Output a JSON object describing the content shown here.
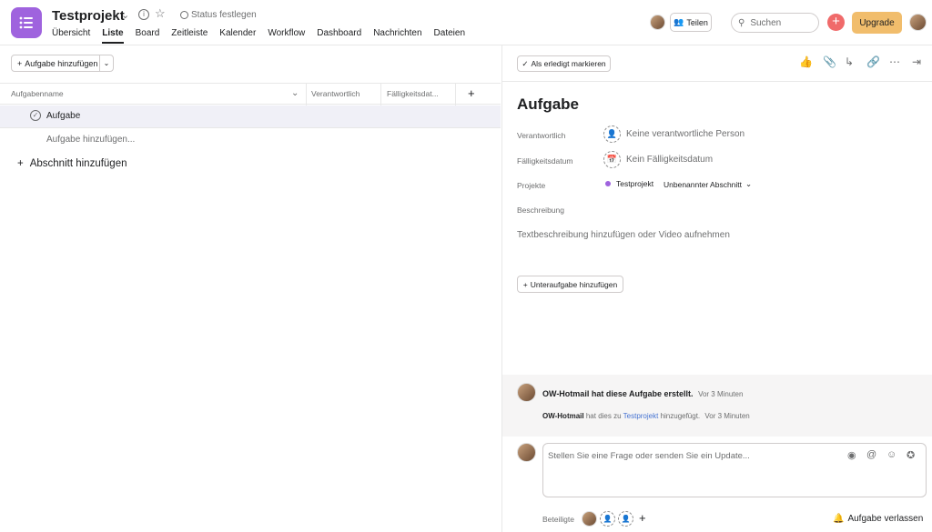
{
  "header": {
    "project_title": "Testprojekt",
    "status_label": "Status festlegen",
    "tabs": [
      "Übersicht",
      "Liste",
      "Board",
      "Zeitleiste",
      "Kalender",
      "Workflow",
      "Dashboard",
      "Nachrichten",
      "Dateien"
    ],
    "active_tab": "Liste",
    "share_label": "Teilen",
    "search_placeholder": "Suchen",
    "upgrade_label": "Upgrade"
  },
  "list": {
    "add_task_label": "Aufgabe hinzufügen",
    "columns": [
      "Aufgabenname",
      "Verantwortlich",
      "Fälligkeitsdat..."
    ],
    "rows": [
      {
        "name": "Aufgabe"
      }
    ],
    "add_task_inline": "Aufgabe hinzufügen...",
    "add_section": "Abschnitt hinzufügen"
  },
  "detail": {
    "mark_done_label": "Als erledigt markieren",
    "title": "Aufgabe",
    "fields": {
      "assignee_label": "Verantwortlich",
      "assignee_value": "Keine verantwortliche Person",
      "due_label": "Fälligkeitsdatum",
      "due_value": "Kein Fälligkeitsdatum",
      "projects_label": "Projekte",
      "project_name": "Testprojekt",
      "section_name": "Unbenannter Abschnitt",
      "description_label": "Beschreibung"
    },
    "description_placeholder": "Textbeschreibung hinzufügen oder Video aufnehmen",
    "add_subtask_label": "Unteraufgabe hinzufügen",
    "activity": {
      "creator": "OW-Hotmail",
      "created_text": "hat diese Aufgabe erstellt.",
      "created_time": "Vor 3 Minuten",
      "added_user": "OW-Hotmail",
      "added_text_pre": "hat dies zu",
      "added_project": "Testprojekt",
      "added_text_post": "hinzugefügt.",
      "added_time": "Vor 3 Minuten"
    },
    "comment_placeholder": "Stellen Sie eine Frage oder senden Sie ein Update...",
    "collaborators_label": "Beteiligte",
    "leave_label": "Aufgabe verlassen"
  },
  "colors": {
    "brand": "#9f63de",
    "accent_red": "#f06a6a",
    "upgrade": "#f1bd6c",
    "link": "#4573d2"
  }
}
